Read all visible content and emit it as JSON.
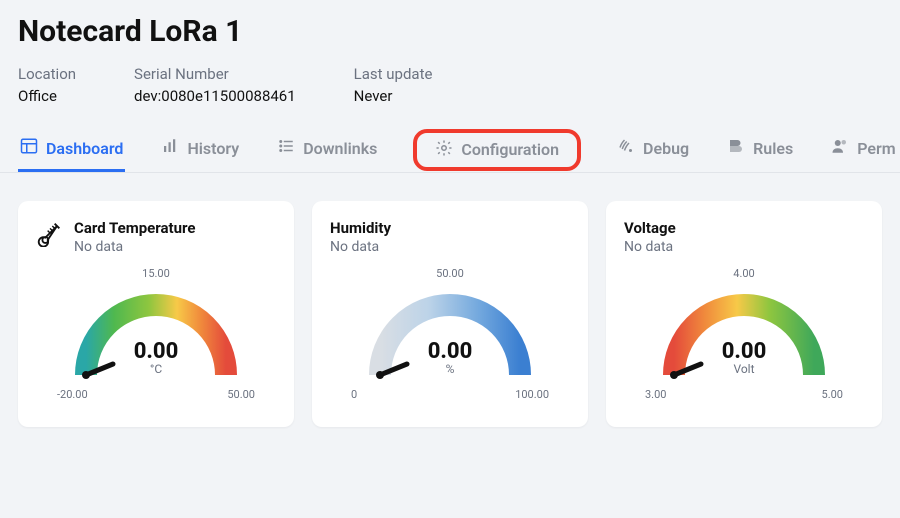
{
  "title": "Notecard LoRa 1",
  "meta": [
    {
      "label": "Location",
      "value": "Office"
    },
    {
      "label": "Serial Number",
      "value": "dev:0080e11500088461"
    },
    {
      "label": "Last update",
      "value": "Never"
    }
  ],
  "tabs": [
    {
      "label": "Dashboard",
      "icon": "dashboard-icon",
      "active": true,
      "highlighted": false
    },
    {
      "label": "History",
      "icon": "history-icon",
      "active": false,
      "highlighted": false
    },
    {
      "label": "Downlinks",
      "icon": "downlinks-icon",
      "active": false,
      "highlighted": false
    },
    {
      "label": "Configuration",
      "icon": "configuration-icon",
      "active": false,
      "highlighted": true
    },
    {
      "label": "Debug",
      "icon": "debug-icon",
      "active": false,
      "highlighted": false
    },
    {
      "label": "Rules",
      "icon": "rules-icon",
      "active": false,
      "highlighted": false
    },
    {
      "label": "Perm",
      "icon": "permissions-icon",
      "active": false,
      "highlighted": false
    }
  ],
  "cards": [
    {
      "title": "Card Temperature",
      "subtitle": "No data",
      "icon": "thermometer-icon",
      "value": "0.00",
      "unit": "°C",
      "min": "-20.00",
      "mid": "15.00",
      "max": "50.00",
      "gradient": "rainbow"
    },
    {
      "title": "Humidity",
      "subtitle": "No data",
      "icon": null,
      "value": "0.00",
      "unit": "%",
      "min": "0",
      "mid": "50.00",
      "max": "100.00",
      "gradient": "blue"
    },
    {
      "title": "Voltage",
      "subtitle": "No data",
      "icon": null,
      "value": "0.00",
      "unit": "Volt",
      "min": "3.00",
      "mid": "4.00",
      "max": "5.00",
      "gradient": "rainbow-rev"
    }
  ]
}
